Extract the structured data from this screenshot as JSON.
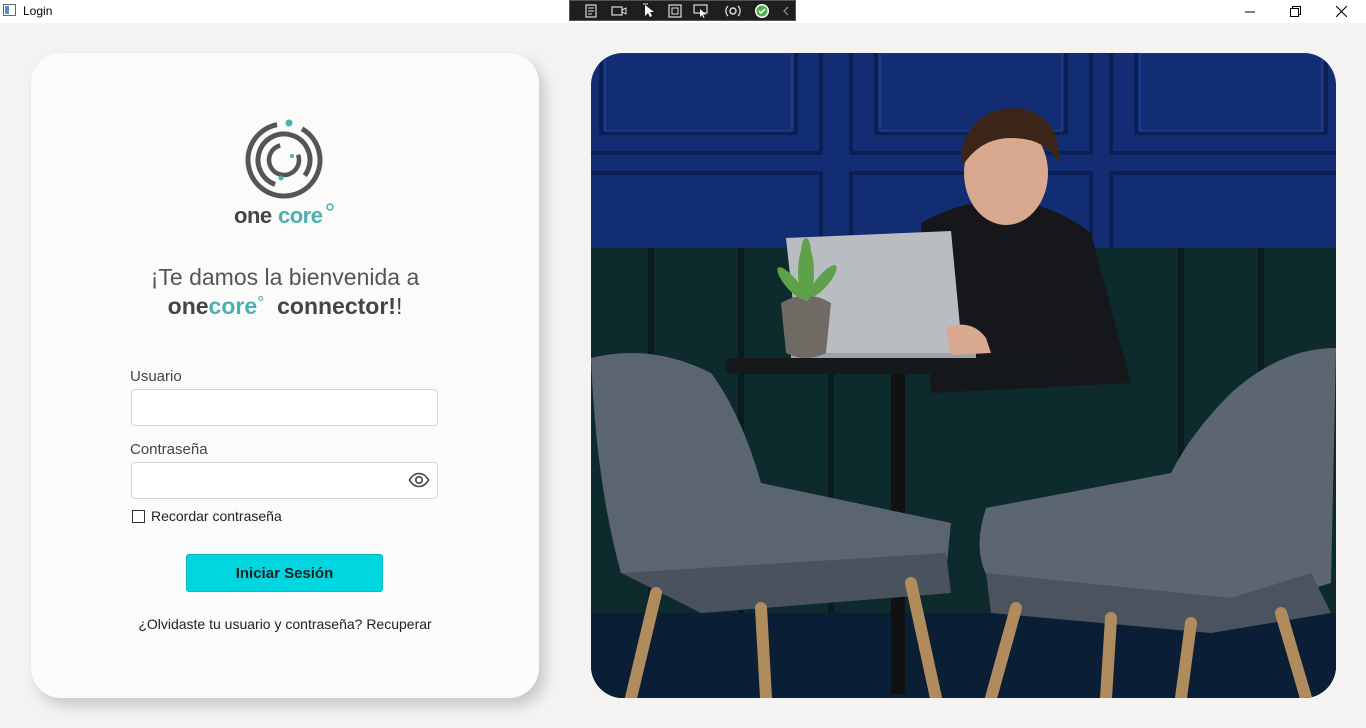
{
  "window": {
    "title": "Login"
  },
  "devtools": {
    "icons": [
      "live-tree-icon",
      "record-icon",
      "select-element-icon",
      "layout-adorner-icon",
      "track-focus-icon",
      "hot-reload-icon",
      "check-icon",
      "collapse-icon"
    ]
  },
  "brand": {
    "name_part1": "one",
    "name_part2": "core",
    "degree": "°",
    "accent": "#4bb0b2"
  },
  "welcome": {
    "line1": "¡Te damos la bienvenida a",
    "suffix": "connector!",
    "excl": "!"
  },
  "form": {
    "user_label": "Usuario",
    "user_value": "",
    "password_label": "Contraseña",
    "password_value": "",
    "remember_label": "Recordar contraseña",
    "remember_checked": false,
    "submit_label": "Iniciar Sesión",
    "forgot_text": "¿Olvidaste tu usuario y contraseña? Recuperar"
  },
  "colors": {
    "button": "#00d5e0",
    "background": "#f4f3f2",
    "card": "#fbfbfa"
  }
}
